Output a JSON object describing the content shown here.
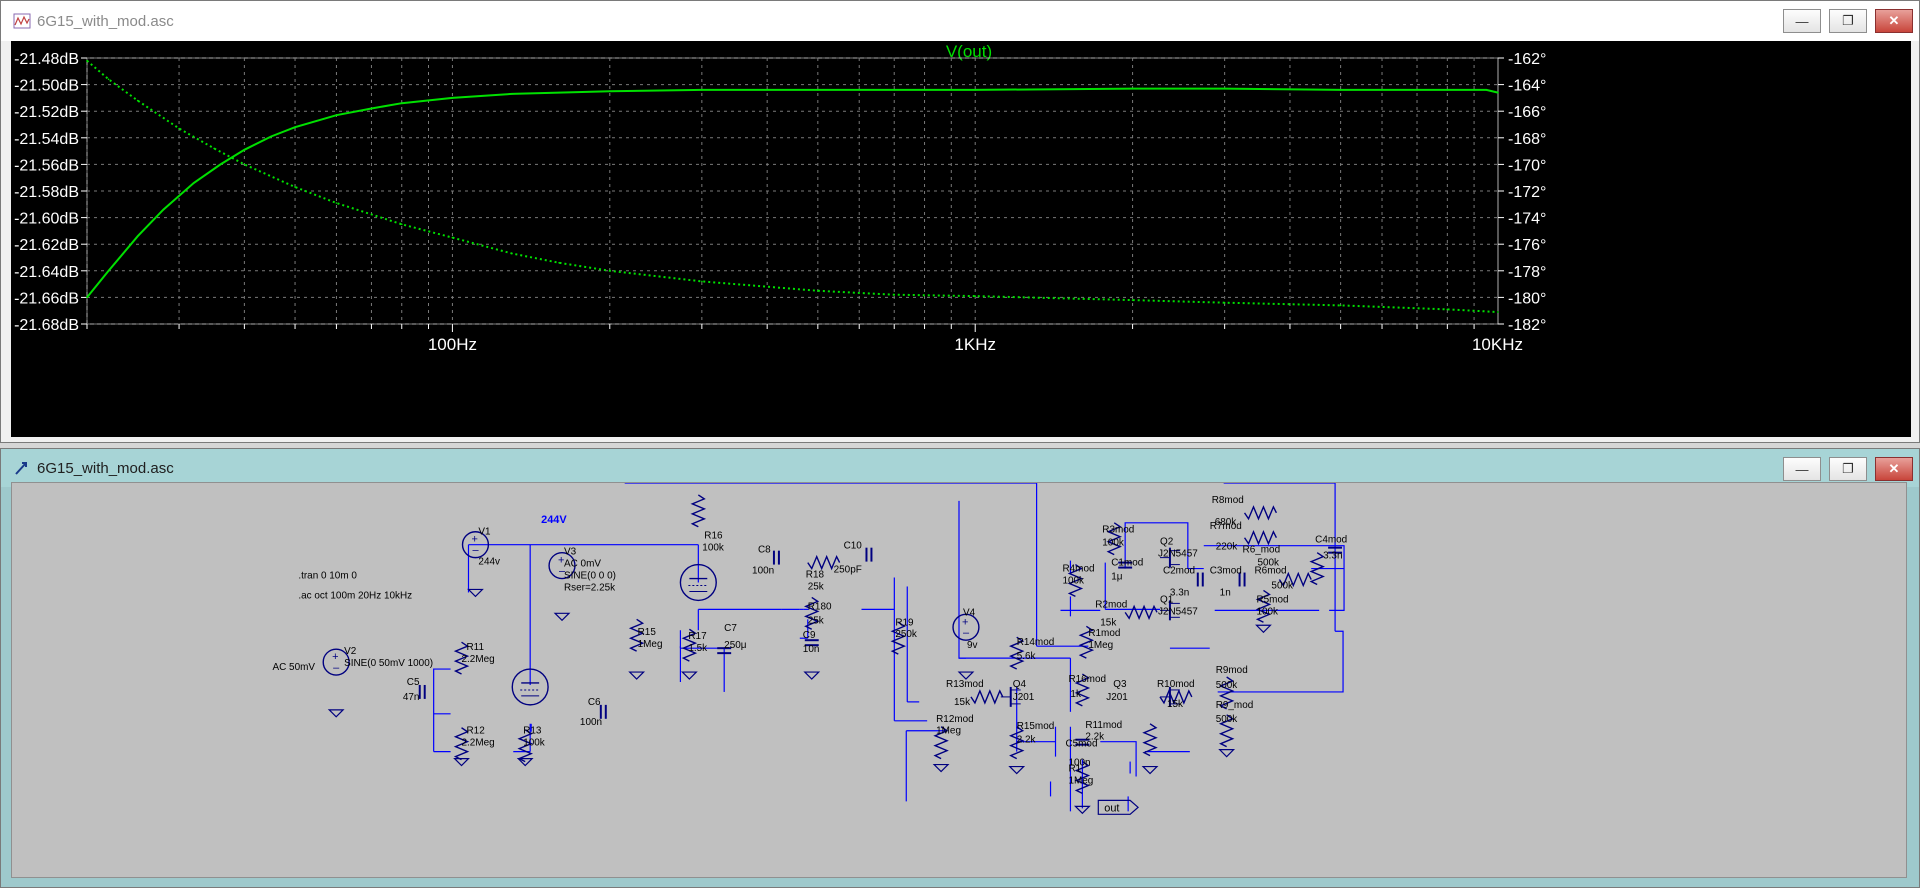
{
  "plot_window": {
    "title": "6G15_with_mod.asc",
    "trace_label": "V(out)",
    "colors": {
      "background": "#000000",
      "trace": "#00e000",
      "axis_text": "#ffffff",
      "grid": "#7a7a7a"
    }
  },
  "chart_data": {
    "type": "line",
    "title": "V(out)",
    "x_scale": "log",
    "xlim": [
      20,
      10000
    ],
    "x_tick_labels": [
      "100Hz",
      "1KHz",
      "10KHz"
    ],
    "y_left_tick_labels": [
      "-21.48dB",
      "-21.50dB",
      "-21.52dB",
      "-21.54dB",
      "-21.56dB",
      "-21.58dB",
      "-21.60dB",
      "-21.62dB",
      "-21.64dB",
      "-21.66dB",
      "-21.68dB"
    ],
    "y_left_lim": [
      -21.68,
      -21.48
    ],
    "y_right_tick_labels": [
      "-162°",
      "-164°",
      "-166°",
      "-168°",
      "-170°",
      "-172°",
      "-174°",
      "-176°",
      "-178°",
      "-180°",
      "-182°"
    ],
    "y_right_lim": [
      -182,
      -162
    ],
    "grid": true,
    "series": [
      {
        "style": "solid",
        "axis": "left",
        "x": [
          20,
          22,
          25,
          28,
          32,
          36,
          40,
          45,
          50,
          60,
          70,
          80,
          100,
          130,
          160,
          200,
          300,
          500,
          1000,
          2000,
          3000,
          5000,
          8000,
          9500,
          10000
        ],
        "y": [
          -21.66,
          -21.64,
          -21.614,
          -21.594,
          -21.574,
          -21.56,
          -21.549,
          -21.539,
          -21.532,
          -21.523,
          -21.518,
          -21.514,
          -21.51,
          -21.507,
          -21.506,
          -21.505,
          -21.504,
          -21.504,
          -21.504,
          -21.503,
          -21.503,
          -21.504,
          -21.504,
          -21.504,
          -21.506
        ]
      },
      {
        "style": "dotted",
        "axis": "right",
        "x": [
          20,
          22,
          25,
          30,
          35,
          40,
          50,
          60,
          80,
          100,
          130,
          160,
          200,
          300,
          500,
          700,
          1000,
          2000,
          3000,
          5000,
          8000,
          10000
        ],
        "y": [
          -162.2,
          -163.6,
          -165.2,
          -167.3,
          -168.8,
          -170.0,
          -171.7,
          -172.9,
          -174.5,
          -175.5,
          -176.7,
          -177.4,
          -178.0,
          -178.8,
          -179.5,
          -179.8,
          -179.9,
          -180.2,
          -180.4,
          -180.6,
          -180.9,
          -181.1
        ]
      }
    ]
  },
  "schematic_window": {
    "title": "6G15_with_mod.asc",
    "net_labels": {
      "supply": "244V",
      "out": "out"
    },
    "directives": [
      ".tran 0 10m 0",
      ".ac oct 100m 20Hz 10kHz"
    ],
    "components": {
      "V1": [
        "V1",
        "244v"
      ],
      "V2": [
        "V2",
        "SINE(0 50mV 1000)",
        "AC 50mV"
      ],
      "V3": [
        "V3",
        "AC 0mV",
        "SINE(0 0 0)",
        "Rser=2.25k"
      ],
      "V4": [
        "V4",
        "9v"
      ],
      "C5": [
        "C5",
        "47n"
      ],
      "C6": [
        "C6",
        "100n"
      ],
      "C7": [
        "C7",
        "250μ"
      ],
      "C8": [
        "C8",
        "100n"
      ],
      "C9": [
        "C9",
        "10n"
      ],
      "C10": [
        "C10",
        "250pF"
      ],
      "R11": [
        "R11",
        "2.2Meg"
      ],
      "R12": [
        "R12",
        "2.2Meg"
      ],
      "R13": [
        "R13",
        "100k"
      ],
      "R15": [
        "R15",
        "1Meg"
      ],
      "R16": [
        "R16",
        "100k"
      ],
      "R17": [
        "R17",
        "1.5k"
      ],
      "R18": [
        "R18",
        "25k"
      ],
      "R180": [
        "R180",
        "25k"
      ],
      "R19": [
        "R19",
        "250k"
      ],
      "R1": [
        "R1",
        "1Meg"
      ],
      "R1mod": [
        "R1mod",
        "1Meg"
      ],
      "R2mod": [
        "R2mod",
        "15k"
      ],
      "R3mod": [
        "R3mod",
        "100k"
      ],
      "R4mod": [
        "R4mod",
        "100k"
      ],
      "R5mod": [
        "R5mod",
        "100k"
      ],
      "R6mod": [
        "R6mod",
        "500k"
      ],
      "R6_mod": [
        "R6_mod",
        "500k"
      ],
      "R7mod": [
        "R7mod",
        "220k"
      ],
      "R8mod": [
        "R8mod",
        "680k"
      ],
      "R9mod": [
        "R9mod",
        "500k"
      ],
      "R9_mod": [
        "R9_mod",
        "500k"
      ],
      "R10mod": [
        "R10mod",
        "15k"
      ],
      "R11mod": [
        "R11mod",
        "2.2k"
      ],
      "R12mod": [
        "R12mod",
        "1Meg"
      ],
      "R13mod": [
        "R13mod",
        "15k"
      ],
      "R14mod": [
        "R14mod",
        "5.6k"
      ],
      "R15mod": [
        "R15mod",
        "2.2k"
      ],
      "R16mod": [
        "R16mod",
        "1k"
      ],
      "C1mod": [
        "C1mod",
        "1μ"
      ],
      "C2mod": [
        "C2mod",
        "3.3n"
      ],
      "C3mod": [
        "C3mod",
        "1n"
      ],
      "C4mod": [
        "C4mod",
        "3.3n"
      ],
      "C5mod": [
        "C5mod",
        "100n"
      ],
      "Q1": [
        "Q1",
        "J2N5457"
      ],
      "Q2": [
        "Q2",
        "J2N5457"
      ],
      "Q3": [
        "Q3",
        "J201"
      ],
      "Q4": [
        "Q4",
        "J201"
      ]
    },
    "colors": {
      "background": "#c0c0c0",
      "wire": "#0000ff",
      "component": "#000080",
      "text": "#000000"
    }
  }
}
